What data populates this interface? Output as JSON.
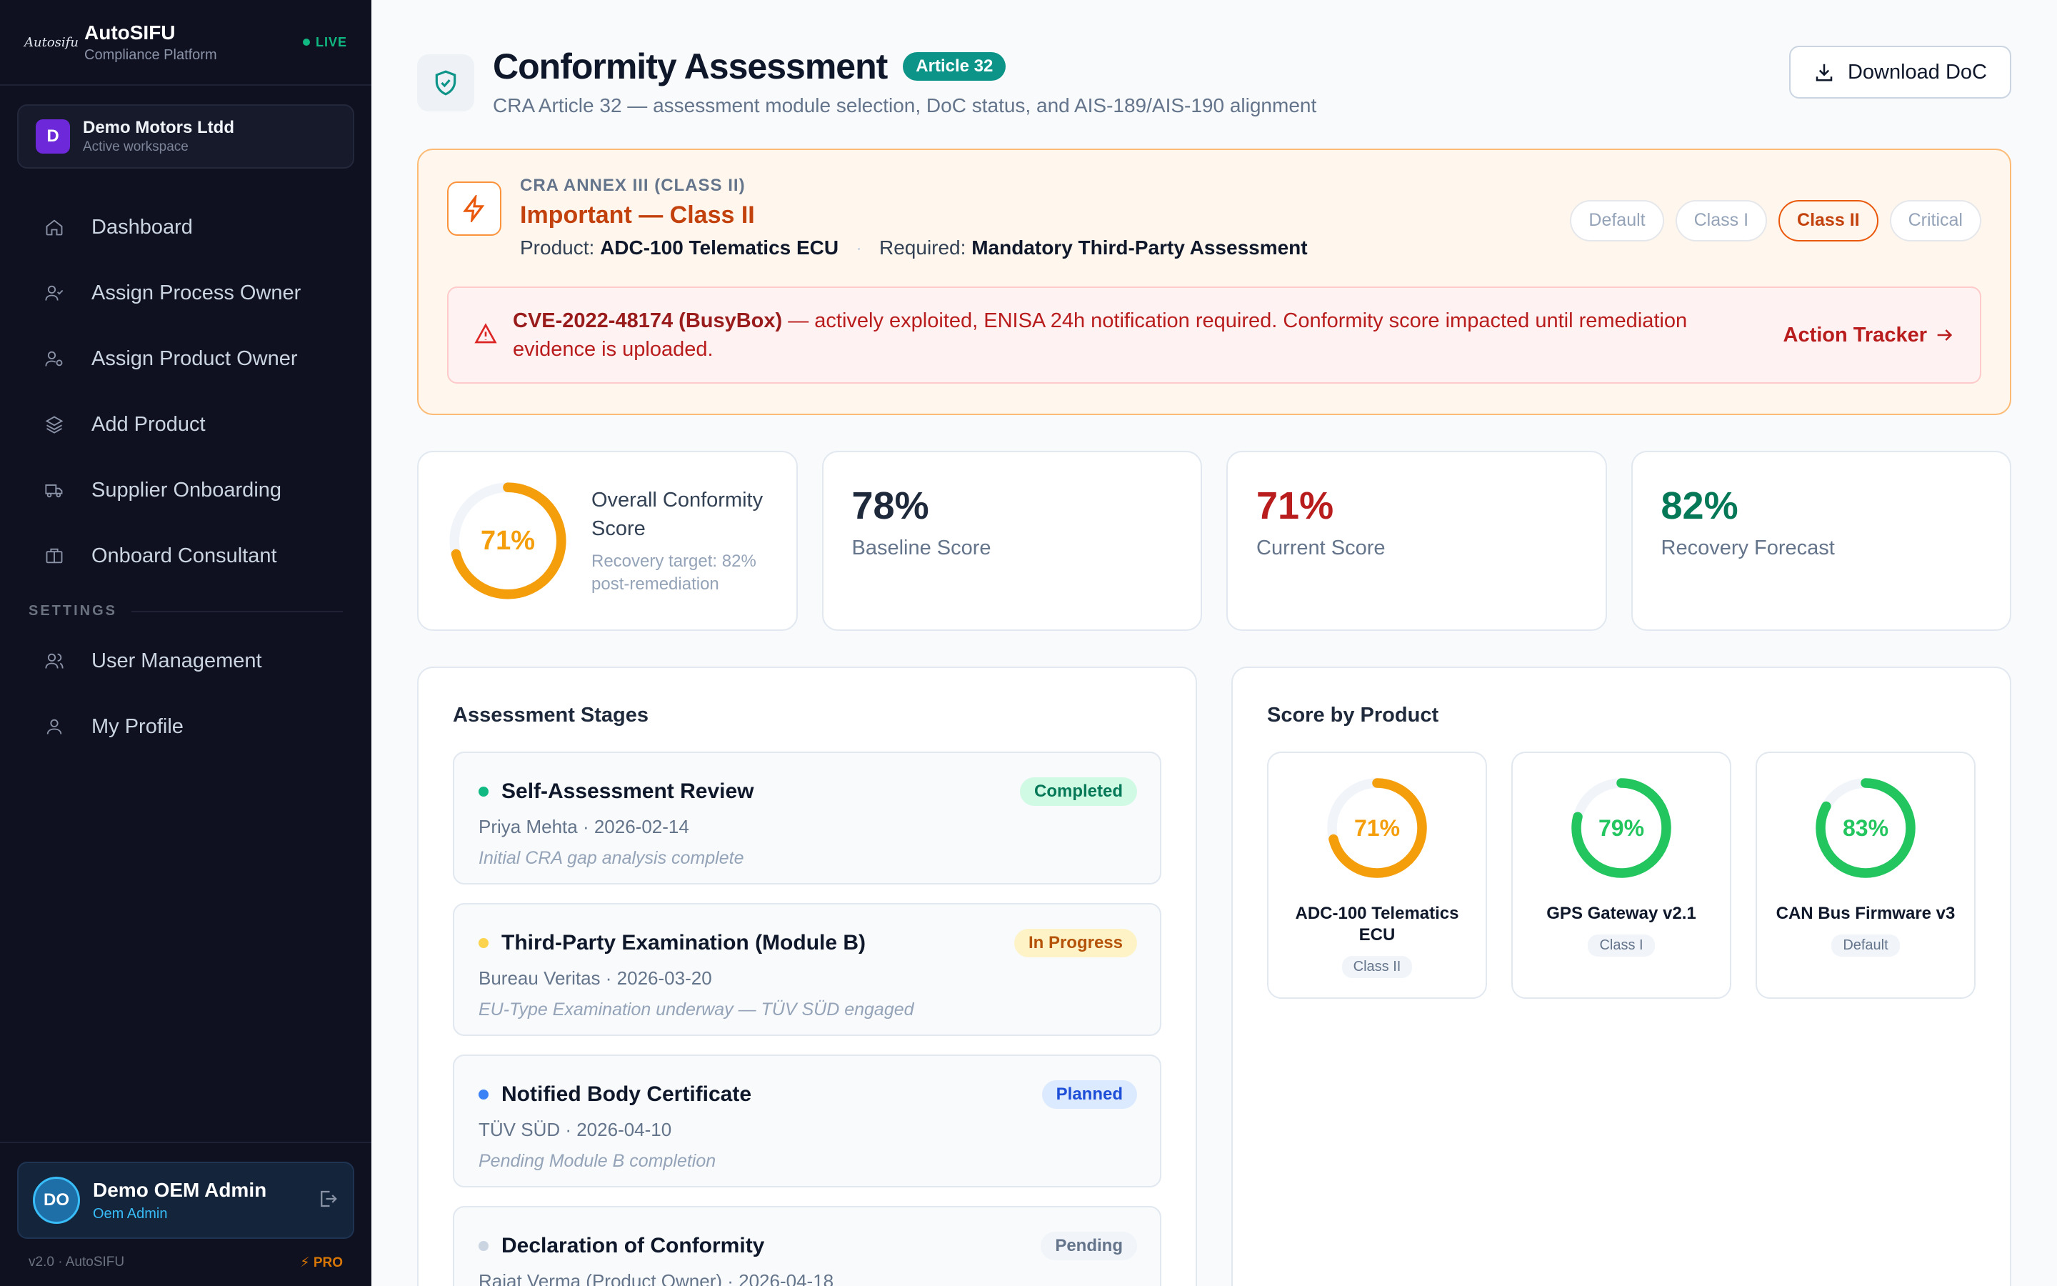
{
  "sidebar": {
    "logo_text": "Autosifu",
    "brand_name": "AutoSIFU",
    "brand_sub": "Compliance Platform",
    "live_label": "LIVE",
    "workspace": {
      "initial": "D",
      "name": "Demo Motors Ltdd",
      "sub": "Active workspace"
    },
    "nav": [
      {
        "label": "Dashboard",
        "icon": "home-icon"
      },
      {
        "label": "Assign Process Owner",
        "icon": "user-check-icon"
      },
      {
        "label": "Assign Product Owner",
        "icon": "user-settings-icon"
      },
      {
        "label": "Add Product",
        "icon": "layers-icon"
      },
      {
        "label": "Supplier Onboarding",
        "icon": "truck-icon"
      },
      {
        "label": "Onboard Consultant",
        "icon": "briefcase-icon"
      }
    ],
    "settings_label": "SETTINGS",
    "settings_nav": [
      {
        "label": "User Management",
        "icon": "users-icon"
      },
      {
        "label": "My Profile",
        "icon": "user-icon"
      }
    ],
    "user": {
      "initials": "DO",
      "name": "Demo OEM Admin",
      "role": "Oem Admin"
    },
    "version": "v2.0 · AutoSIFU",
    "pro_label": "PRO"
  },
  "header": {
    "title": "Conformity Assessment",
    "badge": "Article 32",
    "subtitle": "CRA Article 32 — assessment module selection, DoC status, and AIS-189/AIS-190 alignment",
    "download_label": "Download DoC"
  },
  "annex": {
    "kicker": "CRA ANNEX III (CLASS II)",
    "classification": "Important — Class II",
    "product_label": "Product:",
    "product_value": "ADC-100 Telematics ECU",
    "required_label": "Required:",
    "required_value": "Mandatory Third-Party Assessment",
    "pills": [
      {
        "label": "Default",
        "active": false
      },
      {
        "label": "Class I",
        "active": false
      },
      {
        "label": "Class II",
        "active": true
      },
      {
        "label": "Critical",
        "active": false
      }
    ],
    "cve_id": "CVE-2022-48174 (BusyBox)",
    "cve_message": " — actively exploited, ENISA 24h notification required. Conformity score impacted until remediation evidence is uploaded.",
    "action_label": "Action Tracker"
  },
  "stats": {
    "overall": {
      "value": 71,
      "display": "71%",
      "title": "Overall Conformity Score",
      "sub": "Recovery target: 82% post-remediation",
      "color": "#f59e0b"
    },
    "cards": [
      {
        "value": "78%",
        "label": "Baseline Score",
        "color": "#1e293b"
      },
      {
        "value": "71%",
        "label": "Current Score",
        "color": "#b91c1c"
      },
      {
        "value": "82%",
        "label": "Recovery Forecast",
        "color": "#047857"
      }
    ]
  },
  "stages": {
    "title": "Assessment Stages",
    "items": [
      {
        "name": "Self-Assessment Review",
        "status": "Completed",
        "meta": "Priya Mehta · 2026-02-14",
        "note": "Initial CRA gap analysis complete",
        "dot": "#10b981",
        "badge_bg": "#d1fae5",
        "badge_fg": "#047857"
      },
      {
        "name": "Third-Party Examination (Module B)",
        "status": "In Progress",
        "meta": "Bureau Veritas · 2026-03-20",
        "note": "EU-Type Examination underway — TÜV SÜD engaged",
        "dot": "#fcd34d",
        "badge_bg": "#fef3c7",
        "badge_fg": "#b45309"
      },
      {
        "name": "Notified Body Certificate",
        "status": "Planned",
        "meta": "TÜV SÜD · 2026-04-10",
        "note": "Pending Module B completion",
        "dot": "#3b82f6",
        "badge_bg": "#dbeafe",
        "badge_fg": "#1d4ed8"
      },
      {
        "name": "Declaration of Conformity",
        "status": "Pending",
        "meta": "Rajat Verma (Product Owner) · 2026-04-18",
        "note": "",
        "dot": "#cbd5e1",
        "badge_bg": "#f1f5f9",
        "badge_fg": "#64748b"
      }
    ]
  },
  "products": {
    "title": "Score by Product",
    "items": [
      {
        "name": "ADC-100 Telematics ECU",
        "score": 71,
        "display": "71%",
        "class": "Class II",
        "color": "#f59e0b"
      },
      {
        "name": "GPS Gateway v2.1",
        "score": 79,
        "display": "79%",
        "class": "Class I",
        "color": "#22c55e"
      },
      {
        "name": "CAN Bus Firmware v3",
        "score": 83,
        "display": "83%",
        "class": "Default",
        "color": "#22c55e"
      }
    ]
  }
}
